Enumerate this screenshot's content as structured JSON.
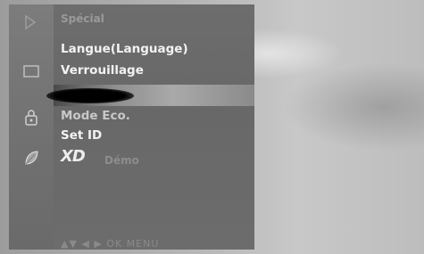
{
  "menu": {
    "title": "Spécial",
    "items": [
      {
        "label": "Langue(Language)"
      },
      {
        "label": "Verrouillage"
      },
      {
        "label": "Mode Eco."
      },
      {
        "label": "Set ID"
      }
    ],
    "xd_logo": "XD",
    "xd_label": "Démo"
  },
  "nav": {
    "hint": "▲▼ ◀ ▶ OK MENU"
  },
  "colors": {
    "panel": "#6d6d6d",
    "text": "#f2f2f2",
    "dim_text": "#9a9a9a"
  },
  "side_icons": [
    "special-icon",
    "screen-icon",
    "lock-icon",
    "leaf-icon"
  ]
}
